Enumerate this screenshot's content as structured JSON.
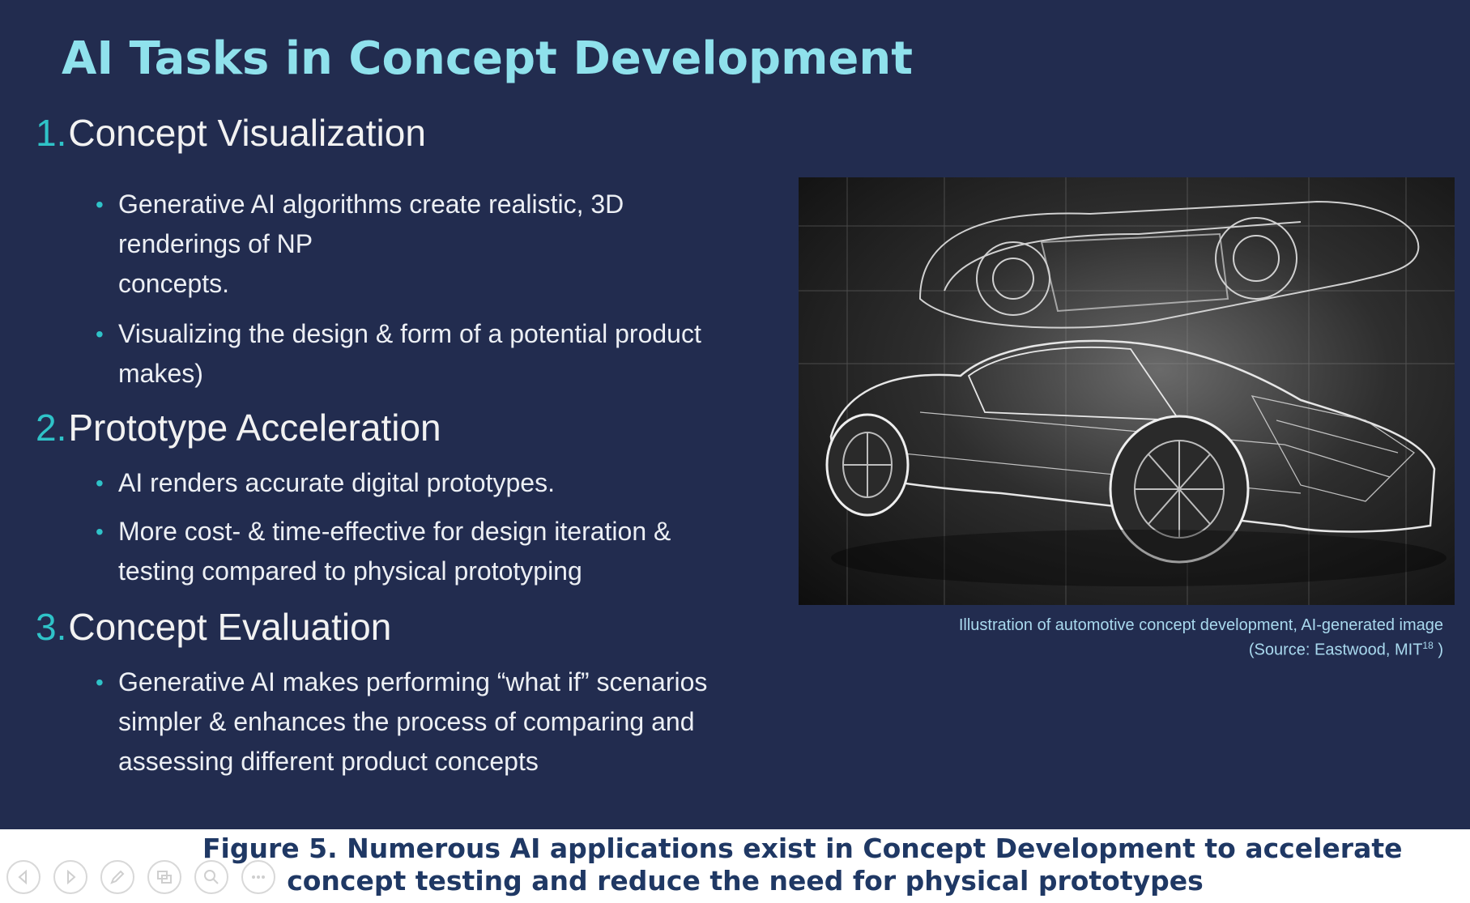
{
  "slide": {
    "title": "AI Tasks in Concept Development",
    "sections": [
      {
        "number": "1.",
        "heading": "Concept Visualization",
        "bullets": [
          {
            "lines": [
              "Generative AI algorithms create realistic, 3D",
              "renderings of NP",
              "concepts."
            ]
          },
          {
            "lines": [
              "Visualizing the design & form of a potential product",
              "makes)"
            ]
          }
        ]
      },
      {
        "number": "2.",
        "heading": "Prototype Acceleration",
        "bullets": [
          {
            "lines": [
              "AI renders accurate digital prototypes."
            ]
          },
          {
            "lines": [
              "More cost- & time-effective for design iteration &",
              "testing compared to physical prototyping"
            ]
          }
        ]
      },
      {
        "number": "3.",
        "heading": "Concept Evaluation",
        "bullets": [
          {
            "lines": [
              "Generative AI makes performing “what if” scenarios",
              "simpler & enhances the process of comparing and",
              "assessing different product concepts"
            ]
          }
        ]
      }
    ],
    "bullet_symbol": "•",
    "image_caption": {
      "line1": "Illustration of automotive concept development, AI-generated image",
      "line2_prefix": "(Source: Eastwood, MIT",
      "superscript": "18",
      "line2_suffix": " )"
    }
  },
  "figure_caption": {
    "line1": "Figure 5. Numerous AI applications exist in Concept Development to accelerate",
    "line2": "concept testing and reduce the need for physical prototypes"
  },
  "toolbar": {
    "buttons": [
      "previous-icon",
      "next-icon",
      "pen-icon",
      "slides-icon",
      "zoom-icon",
      "more-icon"
    ]
  },
  "colors": {
    "slide_background": "#222c4f",
    "title": "#8fe1ec",
    "accent": "#2fc3c8",
    "body_text": "#eceff4",
    "caption": "#a9d9ee",
    "figure_caption": "#1f3864"
  }
}
